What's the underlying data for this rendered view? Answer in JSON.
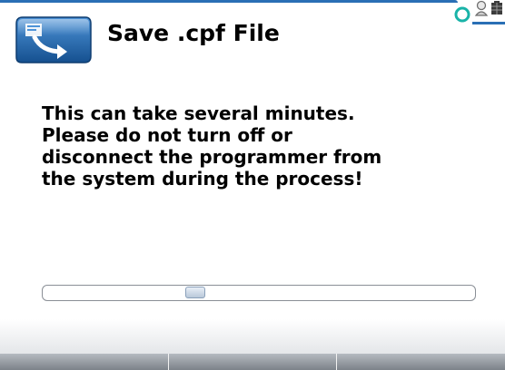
{
  "header": {
    "title": "Save .cpf File",
    "title_icon": "save-to-device-icon",
    "status_icons": [
      "link-icon",
      "person-icon",
      "battery-icon"
    ],
    "accent_color": "#2a6fb5"
  },
  "message": {
    "lines": [
      "This can take several minutes.",
      "Please do not turn off or",
      "disconnect the programmer from",
      "the system during the process!"
    ]
  },
  "progress": {
    "value_fraction": 0.33,
    "indeterminate": true
  },
  "softkeys": [
    {
      "label": ""
    },
    {
      "label": ""
    },
    {
      "label": ""
    }
  ]
}
